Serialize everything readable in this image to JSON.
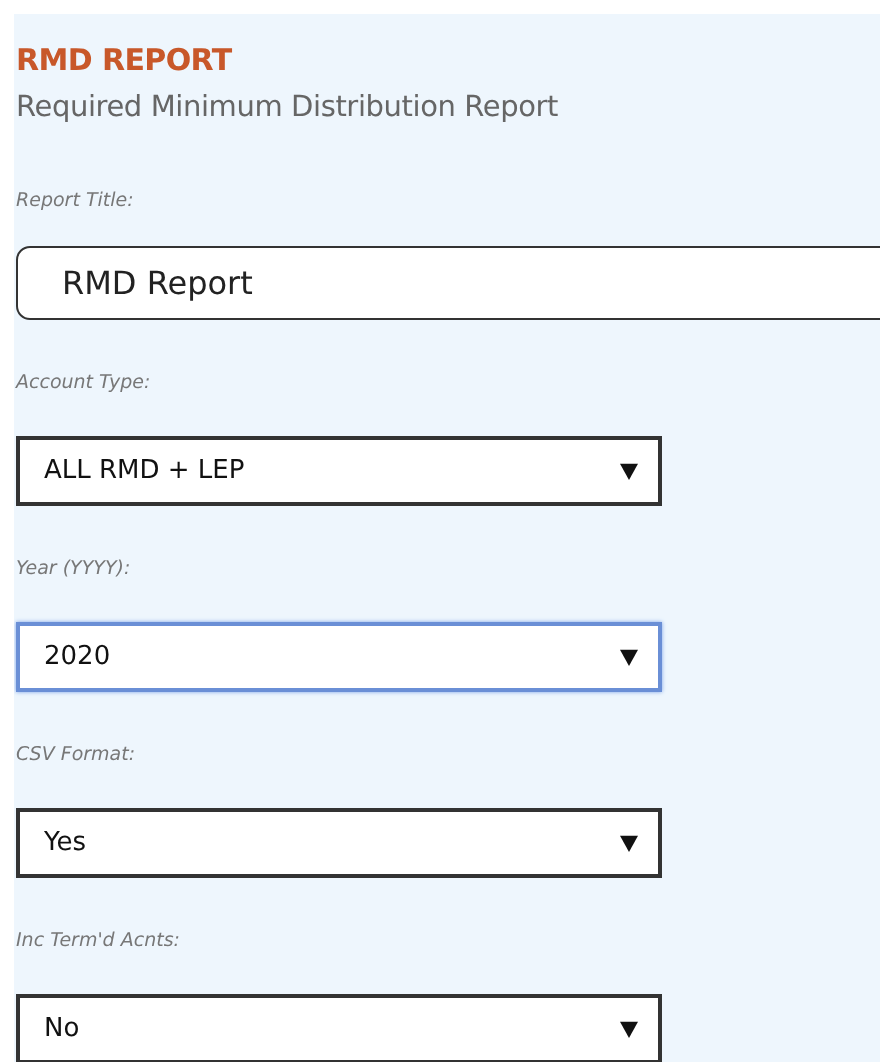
{
  "header": {
    "title": "RMD REPORT",
    "subtitle": "Required Minimum Distribution Report"
  },
  "fields": [
    {
      "kind": "text",
      "label": "Report Title:",
      "value": "RMD Report",
      "focused": false
    },
    {
      "kind": "select",
      "label": "Account Type:",
      "value": "ALL RMD + LEP",
      "focused": false
    },
    {
      "kind": "select",
      "label": "Year (YYYY):",
      "value": "2020",
      "focused": true
    },
    {
      "kind": "select",
      "label": "CSV Format:",
      "value": "Yes",
      "focused": false
    },
    {
      "kind": "select",
      "label": "Inc Term'd Acnts:",
      "value": "No",
      "focused": false
    }
  ]
}
